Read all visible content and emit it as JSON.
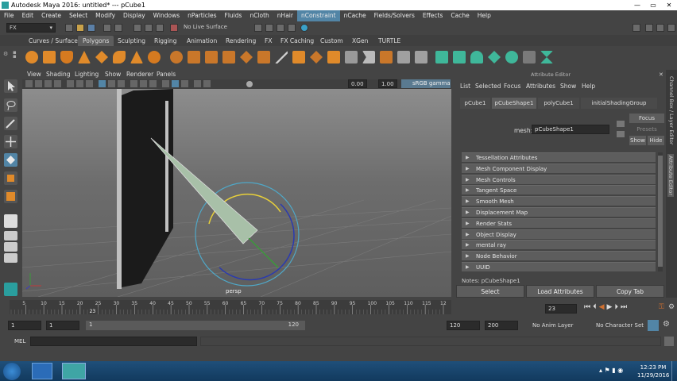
{
  "window": {
    "title": "Autodesk Maya 2016: untitled*   ---   pCube1",
    "controls": [
      "—",
      "▭",
      "✕"
    ]
  },
  "menubar": [
    "File",
    "Edit",
    "Create",
    "Select",
    "Modify",
    "Display",
    "Windows",
    "nParticles",
    "Fluids",
    "nCloth",
    "nHair",
    "nConstraint",
    "nCache",
    "Fields/Solvers",
    "Effects",
    "Cache",
    "Help"
  ],
  "menubar_highlight": "nConstraint",
  "statusline": {
    "mode": "FX",
    "live_surface": "No Live Surface"
  },
  "shelf_tabs": [
    "Curves / Surfaces",
    "Polygons",
    "Sculpting",
    "Rigging",
    "Animation",
    "Rendering",
    "FX",
    "FX Caching",
    "Custom",
    "XGen",
    "TURTLE"
  ],
  "shelf_active": "Polygons",
  "viewport": {
    "menu": [
      "View",
      "Shading",
      "Lighting",
      "Show",
      "Renderer",
      "Panels"
    ],
    "exposure": "0.00",
    "gamma": "1.00",
    "color_space": "sRGB gamma",
    "camera": "persp"
  },
  "attribute_editor": {
    "title": "Attribute Editor",
    "menu": [
      "List",
      "Selected",
      "Focus",
      "Attributes",
      "Show",
      "Help"
    ],
    "node_tabs": [
      "pCube1",
      "pCubeShape1",
      "polyCube1",
      "initialShadingGroup"
    ],
    "active_tab": "pCubeShape1",
    "mesh_label": "mesh:",
    "mesh_value": "pCubeShape1",
    "focus_btn": "Focus",
    "presets_btn": "Presets",
    "show_btn": "Show",
    "hide_btn": "Hide",
    "sections": [
      "Tessellation Attributes",
      "Mesh Component Display",
      "Mesh Controls",
      "Tangent Space",
      "Smooth Mesh",
      "Displacement Map",
      "Render Stats",
      "Object Display",
      "mental ray",
      "Node Behavior",
      "UUID"
    ],
    "notes": "Notes:  pCubeShape1",
    "buttons": [
      "Select",
      "Load Attributes",
      "Copy Tab"
    ],
    "side_tabs": [
      "Channel Box / Layer Editor",
      "Attribute Editor"
    ]
  },
  "timeline": {
    "ticks": [
      "5",
      "10",
      "15",
      "20",
      "25",
      "30",
      "35",
      "40",
      "45",
      "50",
      "55",
      "60",
      "65",
      "70",
      "75",
      "80",
      "85",
      "90",
      "95",
      "100",
      "105",
      "110",
      "115",
      "12"
    ],
    "current_frame_marker": "23",
    "current_frame": "23"
  },
  "range": {
    "start": "1",
    "start2": "1",
    "slider_start": "1",
    "slider_end": "120",
    "end": "120",
    "end2": "200",
    "anim_layer": "No Anim Layer",
    "char_set": "No Character Set"
  },
  "cmdline": {
    "label": "MEL"
  },
  "taskbar": {
    "time": "12:23 PM",
    "date": "11/29/2016"
  }
}
